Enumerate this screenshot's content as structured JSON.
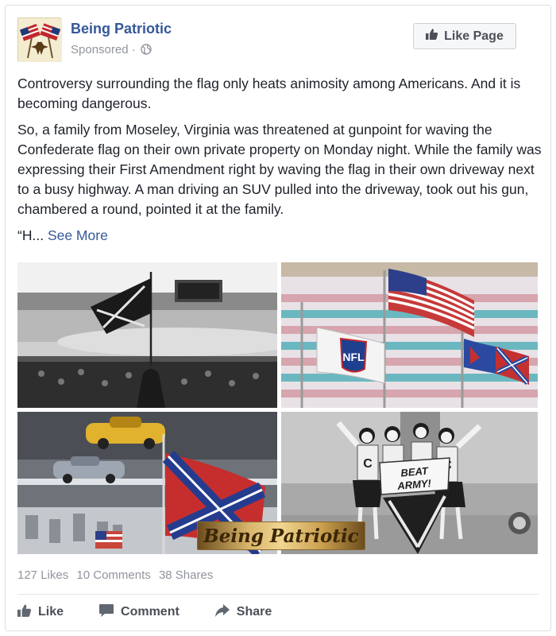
{
  "post": {
    "page_name": "Being Patriotic",
    "sponsored_label": "Sponsored",
    "meta_separator": "·",
    "like_page_label": "Like Page",
    "paragraphs": [
      "Controversy surrounding the flag only heats animosity among Americans. And it is becoming dangerous.",
      "So, a family from Moseley, Virginia was threatened at gunpoint for waving the Confederate flag on their own private property on Monday night. While the family was expressing their First Amendment right by waving the flag in their own driveway next to a busy highway. A man driving an SUV pulled into the driveway, took out his gun, chambered a round, pointed it at the family."
    ],
    "truncated_start": "“H...",
    "see_more_label": "See More"
  },
  "photos": {
    "nfl_flag_text": "NFL",
    "sign_text_line1": "BEAT",
    "sign_text_line2": "ARMY!",
    "shirt_letter": "C",
    "watermark_text": "Being Patriotic"
  },
  "stats": {
    "likes": "127 Likes",
    "comments": "10 Comments",
    "shares": "38 Shares"
  },
  "actions": {
    "like": "Like",
    "comment": "Comment",
    "share": "Share"
  },
  "colors": {
    "link_blue": "#365899",
    "meta_gray": "#90949c",
    "text": "#1d2129"
  },
  "icons": [
    "globe-icon",
    "thumbs-up-icon",
    "speech-bubble-icon",
    "share-arrow-icon"
  ]
}
